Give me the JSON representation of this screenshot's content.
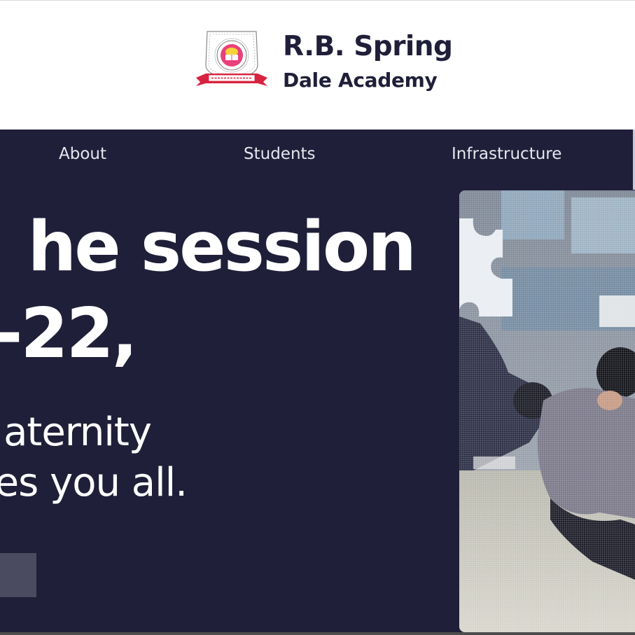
{
  "brand": {
    "name_line1": "R.B. Spring",
    "name_line2": "Dale Academy",
    "logo_motto": "SPREAD LIKE FRAGRANCE",
    "logo_ring_text": "KNOWLEDGE MODESTY SCIENCE TOLERANCE",
    "logo_top_text": "RAJBALA SPRING DALE ACADEMY"
  },
  "nav": {
    "items": [
      {
        "label": "About"
      },
      {
        "label": "Students"
      },
      {
        "label": "Infrastructure"
      }
    ]
  },
  "hero": {
    "headline_line1": "he session",
    "headline_line2": "-22,",
    "sub_line1": "aternity",
    "sub_line2": "es you all.",
    "cta_label": ""
  },
  "colors": {
    "hero_background": "#1f1f39",
    "brand_text": "#1f1f39",
    "nav_text": "#e6e6ee",
    "cta_background": "#4a4a60",
    "logo_red": "#d7233f",
    "logo_pink": "#e8407a",
    "logo_yellow": "#f4d23a"
  },
  "icons": {
    "logo": "school-crest-icon",
    "photo": "students-photo"
  }
}
